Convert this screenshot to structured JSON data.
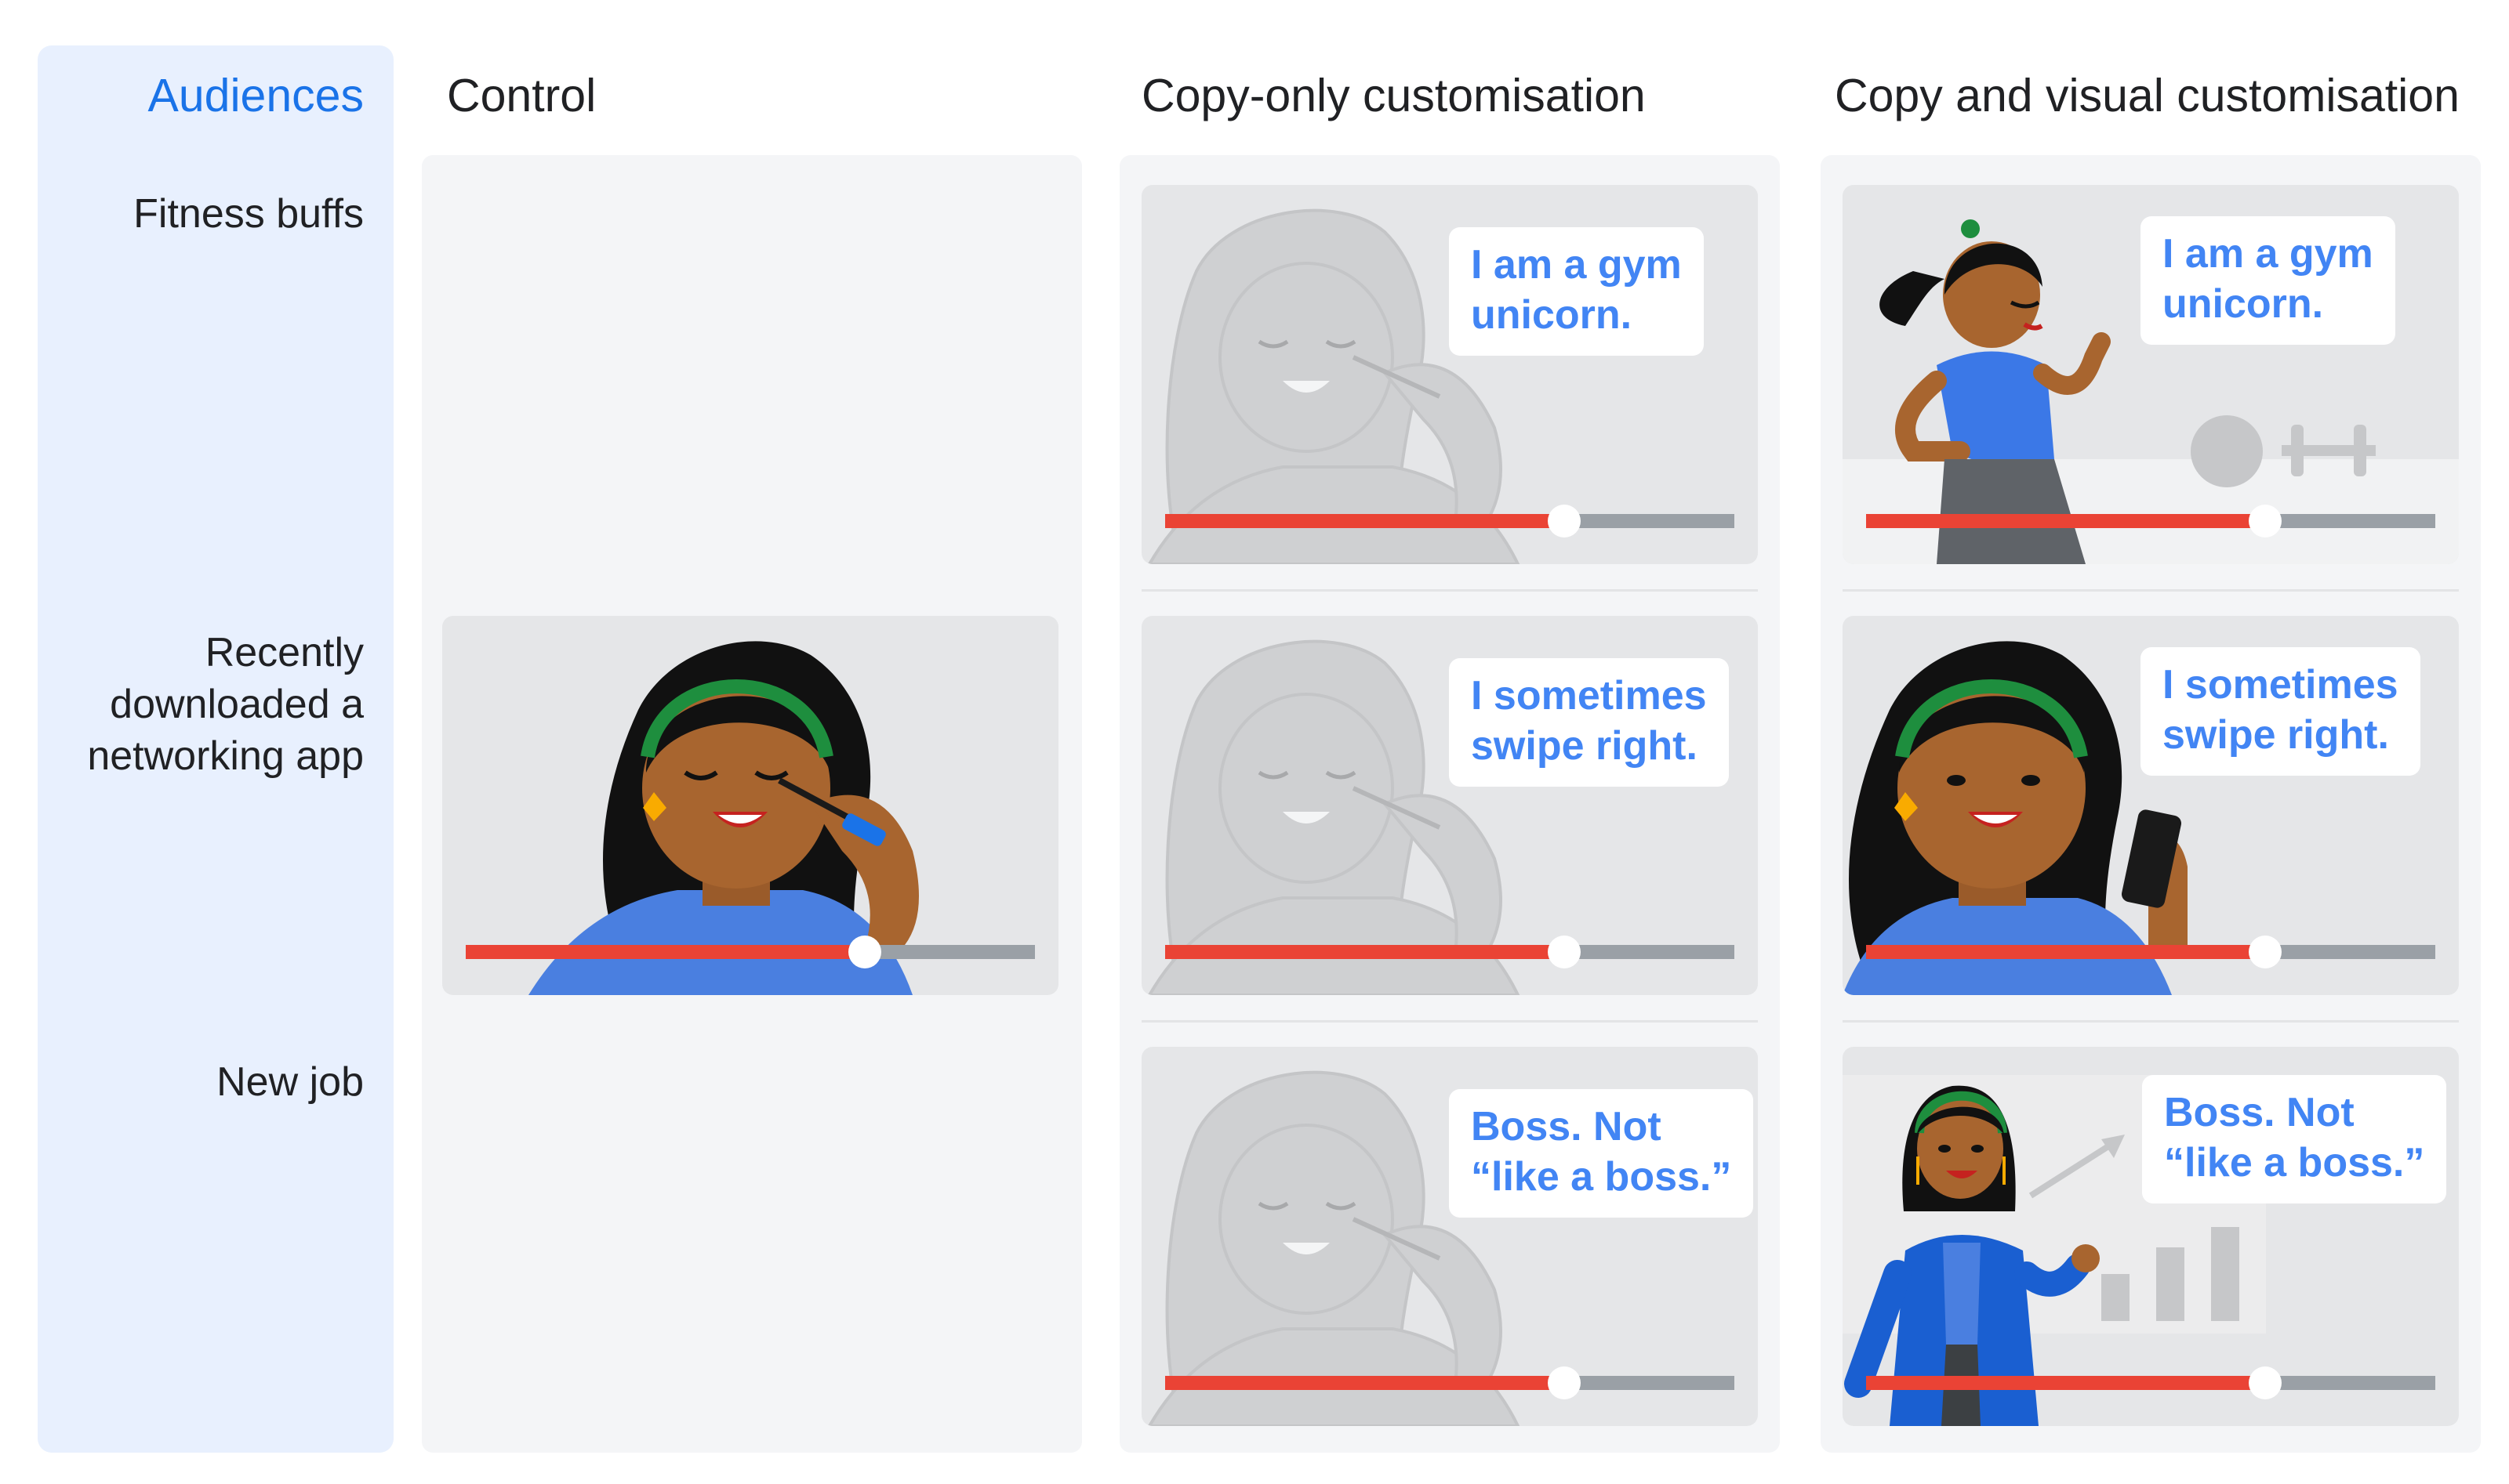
{
  "header": {
    "audiences": "Audiences",
    "control": "Control",
    "copy_only": "Copy-only customisation",
    "copy_visual": "Copy and visual customisation"
  },
  "audiences": [
    {
      "label": "Fitness buffs"
    },
    {
      "label": "Recently downloaded a networking app"
    },
    {
      "label": "New job"
    }
  ],
  "copy_only": [
    {
      "line1": "I am a gym",
      "line2": "unicorn."
    },
    {
      "line1": "I sometimes",
      "line2": "swipe right."
    },
    {
      "line1": "Boss. Not",
      "line2": "“like a boss.”"
    }
  ],
  "copy_visual": [
    {
      "line1": "I am a gym",
      "line2": "unicorn.",
      "illustration": "runner-icon"
    },
    {
      "line1": "I sometimes",
      "line2": "swipe right.",
      "illustration": "phone-icon"
    },
    {
      "line1": "Boss. Not",
      "line2": "“like a boss.”",
      "illustration": "growth-chart-icon"
    }
  ],
  "video_progress": 0.7,
  "colors": {
    "accent": "#1a73e8",
    "bubble_text": "#4285f4",
    "progress": "#ea4335",
    "track": "#9aa0a6",
    "shirt": "#4285f4",
    "headband": "#188038"
  }
}
